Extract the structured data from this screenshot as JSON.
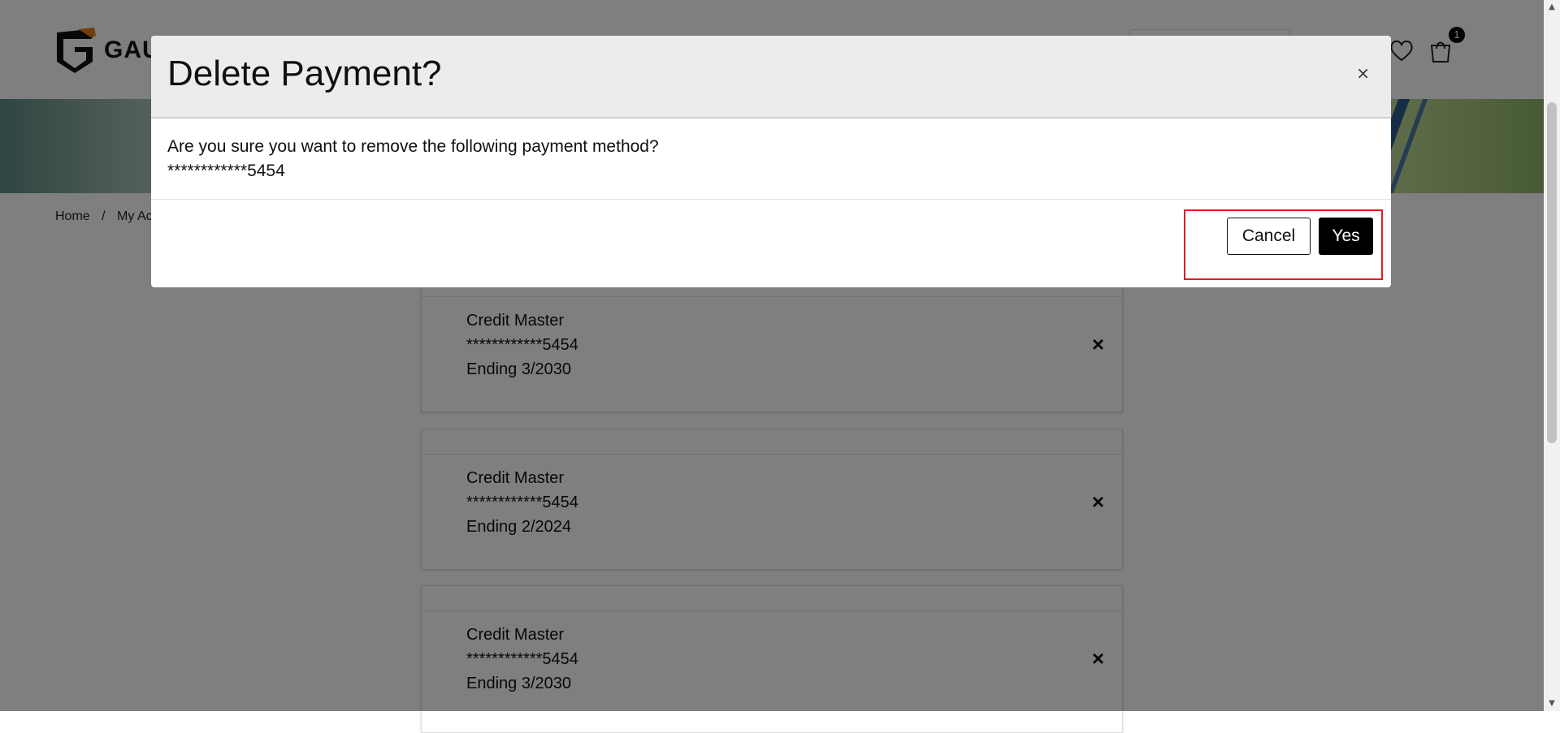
{
  "header": {
    "logo_text": "GAU",
    "cart_count": "1"
  },
  "breadcrumb": {
    "home": "Home",
    "separator": "/",
    "current": "My Ac"
  },
  "cards": [
    {
      "brand": "Credit Master",
      "number": "************5454",
      "expiry": "Ending 3/2030",
      "remove": "×"
    },
    {
      "brand": "Credit Master",
      "number": "************5454",
      "expiry": "Ending 2/2024",
      "remove": "×"
    },
    {
      "brand": "Credit Master",
      "number": "************5454",
      "expiry": "Ending 3/2030",
      "remove": "×"
    }
  ],
  "modal": {
    "title": "Delete Payment?",
    "close": "×",
    "message": "Are you sure you want to remove the following payment method?",
    "card_number": "************5454",
    "cancel_label": "Cancel",
    "confirm_label": "Yes"
  },
  "scrollbar": {
    "up": "▲",
    "down": "▼"
  },
  "colors": {
    "overlay": "#000000",
    "highlight": "#e01b24",
    "primary_button": "#000000"
  }
}
